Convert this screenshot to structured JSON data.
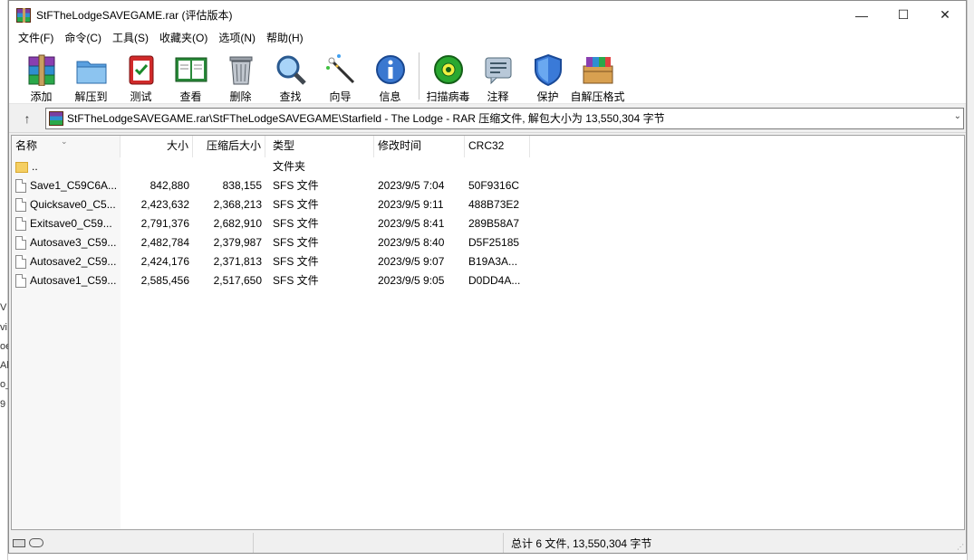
{
  "window": {
    "title": "StFTheLodgeSAVEGAME.rar (评估版本)",
    "minimize": "—",
    "maximize": "☐",
    "close": "✕"
  },
  "menu": [
    "文件(F)",
    "命令(C)",
    "工具(S)",
    "收藏夹(O)",
    "选项(N)",
    "帮助(H)"
  ],
  "toolbar": [
    {
      "label": "添加",
      "icon": "add-archive-icon"
    },
    {
      "label": "解压到",
      "icon": "extract-folder-icon"
    },
    {
      "label": "测试",
      "icon": "test-clipboard-icon"
    },
    {
      "label": "查看",
      "icon": "view-book-icon"
    },
    {
      "label": "删除",
      "icon": "trash-icon"
    },
    {
      "label": "查找",
      "icon": "magnifier-icon"
    },
    {
      "label": "向导",
      "icon": "wizard-wand-icon"
    },
    {
      "label": "信息",
      "icon": "info-icon"
    },
    {
      "label": "扫描病毒",
      "icon": "virus-scan-icon"
    },
    {
      "label": "注释",
      "icon": "comment-icon"
    },
    {
      "label": "保护",
      "icon": "shield-icon"
    },
    {
      "label": "自解压格式",
      "icon": "sfx-box-icon"
    }
  ],
  "address": {
    "path": "StFTheLodgeSAVEGAME.rar\\StFTheLodgeSAVEGAME\\Starfield - The Lodge - RAR 压缩文件, 解包大小为 13,550,304 字节"
  },
  "columns": {
    "name": "名称",
    "size": "大小",
    "packed": "压缩后大小",
    "type": "类型",
    "modified": "修改时间",
    "crc": "CRC32"
  },
  "rows": [
    {
      "name": "..",
      "size": "",
      "packed": "",
      "type": "文件夹",
      "modified": "",
      "crc": "",
      "folder": true
    },
    {
      "name": "Save1_C59C6A...",
      "size": "842,880",
      "packed": "838,155",
      "type": "SFS 文件",
      "modified": "2023/9/5 7:04",
      "crc": "50F9316C"
    },
    {
      "name": "Quicksave0_C5...",
      "size": "2,423,632",
      "packed": "2,368,213",
      "type": "SFS 文件",
      "modified": "2023/9/5 9:11",
      "crc": "488B73E2"
    },
    {
      "name": "Exitsave0_C59...",
      "size": "2,791,376",
      "packed": "2,682,910",
      "type": "SFS 文件",
      "modified": "2023/9/5 8:41",
      "crc": "289B58A7"
    },
    {
      "name": "Autosave3_C59...",
      "size": "2,482,784",
      "packed": "2,379,987",
      "type": "SFS 文件",
      "modified": "2023/9/5 8:40",
      "crc": "D5F25185"
    },
    {
      "name": "Autosave2_C59...",
      "size": "2,424,176",
      "packed": "2,371,813",
      "type": "SFS 文件",
      "modified": "2023/9/5 9:07",
      "crc": "B19A3A..."
    },
    {
      "name": "Autosave1_C59...",
      "size": "2,585,456",
      "packed": "2,517,650",
      "type": "SFS 文件",
      "modified": "2023/9/5 9:05",
      "crc": "D0DD4A..."
    }
  ],
  "status": {
    "total": "总计 6 文件, 13,550,304 字节"
  },
  "background": {
    "edge_letters": [
      "V",
      "vi",
      "oe",
      "All",
      "o_",
      "9"
    ]
  }
}
